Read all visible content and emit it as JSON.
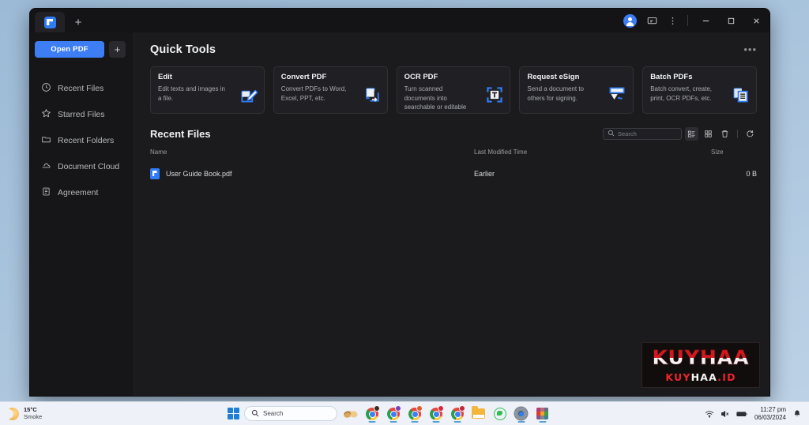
{
  "window": {
    "tab_icon": "pdf-app-logo-icon",
    "new_tab_label": "+",
    "controls": {
      "avatar": "user-avatar",
      "feedback": "feedback-icon",
      "more": "more-vertical-icon",
      "minimize": "—",
      "maximize": "☐",
      "close": "✕"
    }
  },
  "sidebar": {
    "open_button": "Open PDF",
    "plus_button": "+",
    "items": [
      {
        "label": "Recent Files",
        "icon": "clock-icon"
      },
      {
        "label": "Starred Files",
        "icon": "star-icon"
      },
      {
        "label": "Recent Folders",
        "icon": "folder-icon"
      },
      {
        "label": "Document Cloud",
        "icon": "cloud-icon"
      },
      {
        "label": "Agreement",
        "icon": "agreement-document-icon"
      }
    ]
  },
  "quick_tools": {
    "title": "Quick Tools",
    "more_label": "•••",
    "cards": [
      {
        "title": "Edit",
        "desc": "Edit texts and images in a file.",
        "icon": "edit-pencil-icon"
      },
      {
        "title": "Convert PDF",
        "desc": "Convert PDFs to Word, Excel, PPT, etc.",
        "icon": "convert-arrow-icon"
      },
      {
        "title": "OCR PDF",
        "desc": "Turn scanned documents into searchable or editable text.",
        "icon": "ocr-text-scan-icon"
      },
      {
        "title": "Request eSign",
        "desc": "Send a document to others for signing.",
        "icon": "esign-signature-icon"
      },
      {
        "title": "Batch PDFs",
        "desc": "Batch convert, create, print, OCR PDFs, etc.",
        "icon": "batch-documents-icon"
      }
    ]
  },
  "recent_files": {
    "title": "Recent Files",
    "search_placeholder": "Search",
    "toolbar": [
      {
        "name": "list-view-icon",
        "active": true
      },
      {
        "name": "grid-view-icon",
        "active": false
      },
      {
        "name": "trash-icon",
        "active": false
      },
      {
        "name": "refresh-icon",
        "active": false
      }
    ],
    "columns": [
      "Name",
      "Last Modified Time",
      "Size"
    ],
    "rows": [
      {
        "name": "User Guide Book.pdf",
        "modified": "Earlier",
        "size": "0 B",
        "icon": "pdf-file-icon"
      }
    ]
  },
  "watermark": {
    "top": "KUYHAA",
    "bottom_part1": "KUY",
    "bottom_part2": "HAA",
    "bottom_part3": ".ID"
  },
  "taskbar": {
    "weather_temp": "15°C",
    "weather_desc": "Smoke",
    "search_placeholder": "Search",
    "start_icon": "windows-start-icon",
    "apps": [
      {
        "name": "taskbar-app-shells-icon"
      },
      {
        "name": "taskbar-chrome-1-icon"
      },
      {
        "name": "taskbar-chrome-2-icon"
      },
      {
        "name": "taskbar-chrome-3-icon"
      },
      {
        "name": "taskbar-chrome-4-icon"
      },
      {
        "name": "taskbar-chrome-5-icon"
      },
      {
        "name": "taskbar-file-explorer-icon"
      },
      {
        "name": "taskbar-whatsapp-icon"
      },
      {
        "name": "taskbar-settings-icon"
      },
      {
        "name": "taskbar-color-app-icon"
      }
    ],
    "tray": {
      "wifi": "wifi-icon",
      "volume": "volume-muted-icon",
      "battery": "battery-icon",
      "time": "11:27 pm",
      "date": "06/03/2024",
      "notification": "bell-icon"
    }
  },
  "colors": {
    "accent": "#3d7ef5",
    "window_bg": "#1b1b1d",
    "sidebar_bg": "#161618",
    "card_bg": "#202024",
    "watermark_red": "#d31920"
  }
}
